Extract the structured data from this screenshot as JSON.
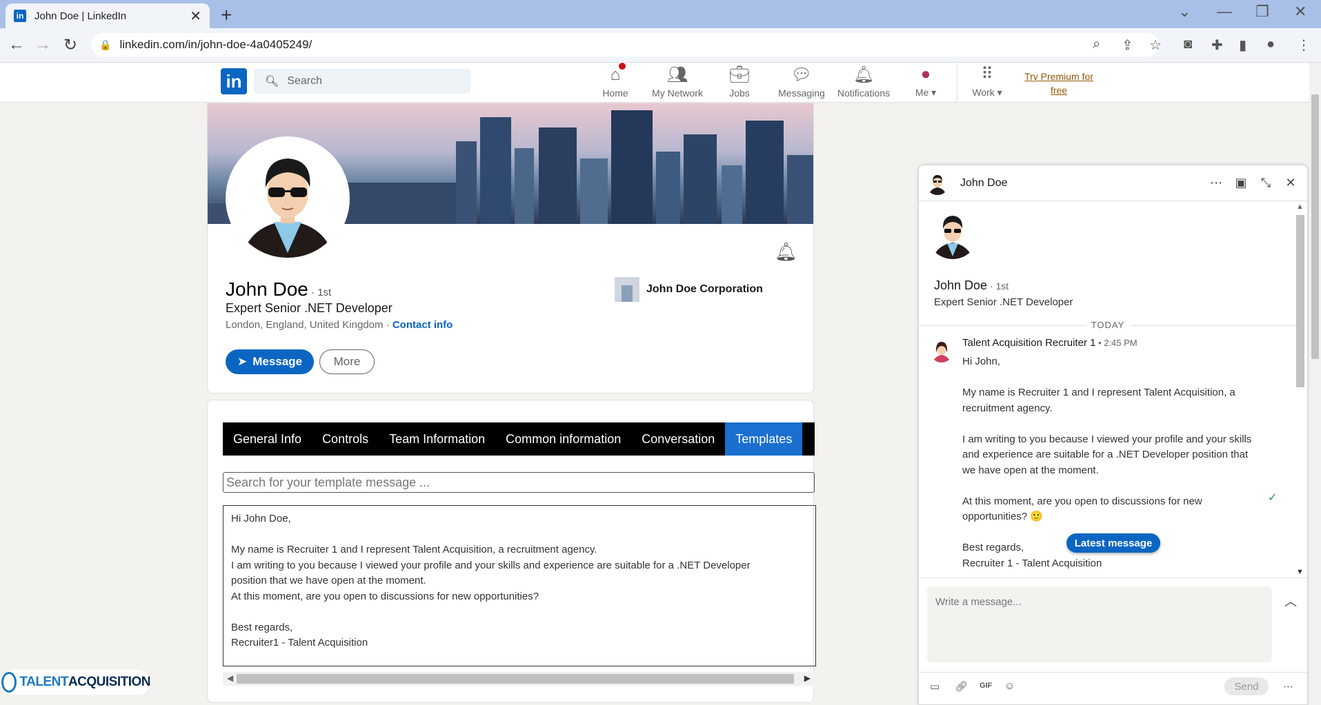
{
  "browser": {
    "tab_title": "John Doe | LinkedIn",
    "favicon_text": "in",
    "url": "linkedin.com/in/john-doe-4a0405249/"
  },
  "linkedin": {
    "logo_text": "in",
    "search_placeholder": "Search",
    "nav": [
      {
        "label": "Home",
        "icon": "home-icon"
      },
      {
        "label": "My Network",
        "icon": "network-icon"
      },
      {
        "label": "Jobs",
        "icon": "briefcase-icon"
      },
      {
        "label": "Messaging",
        "icon": "chat-icon"
      },
      {
        "label": "Notifications",
        "icon": "bell-icon"
      },
      {
        "label": "Me",
        "icon": "avatar-icon"
      },
      {
        "label": "Work",
        "icon": "grid-icon"
      }
    ],
    "premium_line1": "Try Premium for",
    "premium_line2": "free"
  },
  "profile": {
    "name": "John Doe",
    "degree": " · 1st",
    "headline": "Expert Senior .NET Developer",
    "location": "London, England, United Kingdom · ",
    "contact_info": "Contact info",
    "message_button": "Message",
    "more_button": "More",
    "company": "John Doe Corporation"
  },
  "templates_panel": {
    "tabs": [
      "General Info",
      "Controls",
      "Team Information",
      "Common information",
      "Conversation",
      "Templates"
    ],
    "active_tab": "Templates",
    "search_placeholder": "Search for your template message ...",
    "template_text": "Hi John Doe,\n\nMy name is Recruiter 1 and I represent Talent Acquisition, a recruitment agency.\nI am writing to you because I viewed your profile and your skills and experience are suitable for a .NET Developer\nposition that we have open at the moment.\nAt this moment, are you open to discussions for new opportunities?\n\nBest regards,\nRecruiter1 - Talent Acquisition"
  },
  "watermark": {
    "part1": "TALENT",
    "part2": "ACQUISITION"
  },
  "chat": {
    "header_name": "John Doe",
    "profile_name": "John Doe",
    "profile_degree": " · 1st",
    "profile_headline": "Expert Senior .NET Developer",
    "day_separator": "TODAY",
    "sender": "Talent Acquisition Recruiter 1",
    "time": " • 2:45 PM",
    "message": "Hi John,\n\nMy name is Recruiter 1 and I represent Talent Acquisition, a recruitment agency.\n\nI am writing to you because I viewed your profile and your skills and experience are suitable for a .NET Developer position that we have open at the moment.\n\nAt this moment, are you open to discussions for new opportunities? 🙂\n\nBest regards,\nRecruiter 1 - Talent Acquisition",
    "latest_message": "Latest message",
    "compose_placeholder": "Write a message...",
    "send_button": "Send",
    "gif_label": "GIF"
  },
  "colors": {
    "linkedin_blue": "#0a66c2",
    "tab_active": "#1a6fd0",
    "premium": "#915907"
  }
}
